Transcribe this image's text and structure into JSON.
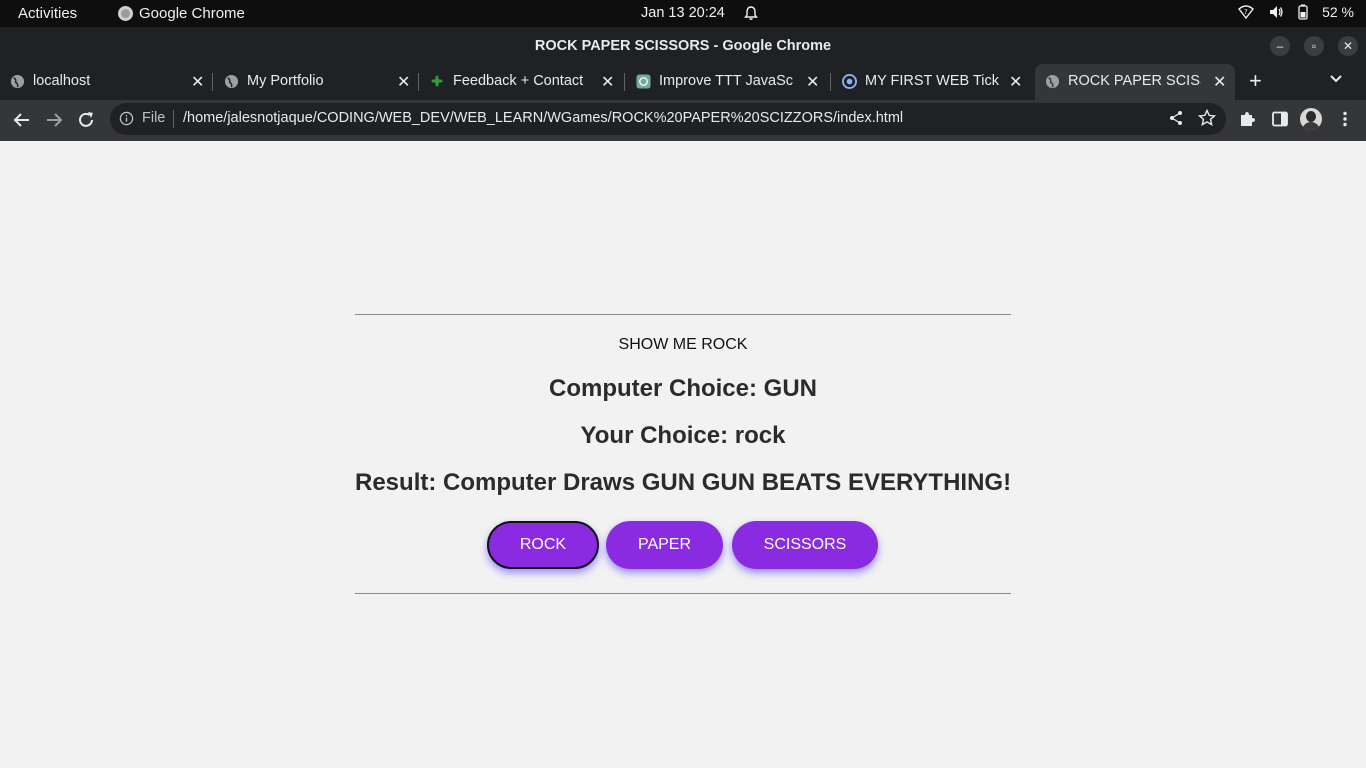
{
  "system": {
    "activities": "Activities",
    "app_name": "Google Chrome",
    "clock": "Jan 13  20:24",
    "battery": "52 %"
  },
  "window": {
    "title": "ROCK PAPER SCISSORS - Google Chrome"
  },
  "tabs": [
    {
      "label": "localhost",
      "icon": "globe-icon"
    },
    {
      "label": "My Portfolio",
      "icon": "globe-icon"
    },
    {
      "label": "Feedback + Contact",
      "icon": "feedback-icon"
    },
    {
      "label": "Improve TTT JavaSc",
      "icon": "chatgpt-icon"
    },
    {
      "label": "MY FIRST WEB Tick-",
      "icon": "web-icon"
    },
    {
      "label": "ROCK PAPER SCISSO",
      "icon": "globe-icon",
      "active": true
    }
  ],
  "toolbar": {
    "file_label": "File",
    "url": "/home/jalesnotjaque/CODING/WEB_DEV/WEB_LEARN/WGames/ROCK%20PAPER%20SCIZZORS/index.html"
  },
  "game": {
    "show_me": "SHOW ME ROCK",
    "computer_choice": "Computer Choice: GUN",
    "your_choice": "Your Choice: rock",
    "result": "Result: Computer Draws GUN GUN BEATS EVERYTHING!",
    "buttons": {
      "rock": "ROCK",
      "paper": "PAPER",
      "scissors": "SCISSORS"
    }
  },
  "colors": {
    "button_bg": "#8a2be2",
    "page_bg": "#f2f2f2"
  }
}
